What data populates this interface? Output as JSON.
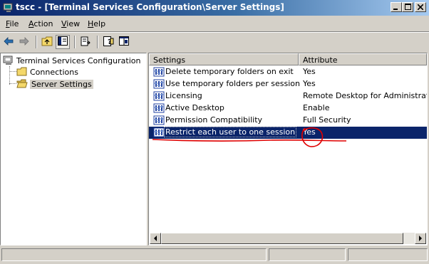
{
  "window": {
    "title": "tscc - [Terminal Services Configuration\\Server Settings]",
    "controls": [
      "minimize-icon",
      "maximize-icon",
      "close-icon"
    ]
  },
  "menu": {
    "items": [
      {
        "label": "File",
        "accel": "F",
        "rest": "ile"
      },
      {
        "label": "Action",
        "accel": "A",
        "rest": "ction"
      },
      {
        "label": "View",
        "accel": "V",
        "rest": "iew"
      },
      {
        "label": "Help",
        "accel": "H",
        "rest": "elp"
      }
    ]
  },
  "toolbar": {
    "icons": [
      "back-arrow-icon",
      "forward-arrow-icon",
      "up-folder-icon",
      "show-hide-tree-icon",
      "export-list-icon",
      "help-icon",
      "properties-icon"
    ]
  },
  "tree": {
    "root": "Terminal Services Configuration",
    "children": [
      "Connections",
      "Server Settings"
    ],
    "selected": "Server Settings"
  },
  "list": {
    "columns": [
      "Settings",
      "Attribute"
    ],
    "rows": [
      {
        "setting": "Delete temporary folders on exit",
        "attribute": "Yes"
      },
      {
        "setting": "Use temporary folders per session",
        "attribute": "Yes"
      },
      {
        "setting": "Licensing",
        "attribute": "Remote Desktop for Administration"
      },
      {
        "setting": "Active Desktop",
        "attribute": "Enable"
      },
      {
        "setting": "Permission Compatibility",
        "attribute": "Full Security"
      },
      {
        "setting": "Restrict each user to one session",
        "attribute": "Yes"
      }
    ],
    "selected_row": 5
  },
  "annotation": {
    "color": "#e00000"
  },
  "colors": {
    "selection": "#0a246a",
    "face": "#d4d0c8"
  }
}
